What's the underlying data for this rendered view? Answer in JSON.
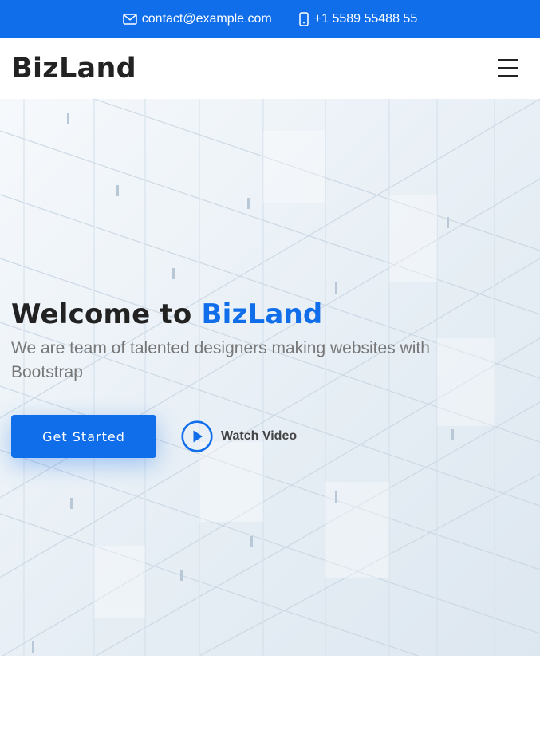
{
  "topbar": {
    "email": "contact@example.com",
    "phone": "+1 5589 55488 55",
    "email_icon": "envelope-icon",
    "phone_icon": "phone-icon",
    "background": "#106eea"
  },
  "header": {
    "logo": "BizLand",
    "menu_icon": "hamburger-menu-icon"
  },
  "hero": {
    "title_prefix": "Welcome to ",
    "title_accent": "BizLand",
    "subtitle": "We are team of talented designers making websites with Bootstrap",
    "cta_label": "Get Started",
    "video_label": "Watch Video",
    "video_icon": "play-circle-icon"
  },
  "colors": {
    "accent": "#106eea",
    "heading": "#222222",
    "muted": "#777777"
  }
}
